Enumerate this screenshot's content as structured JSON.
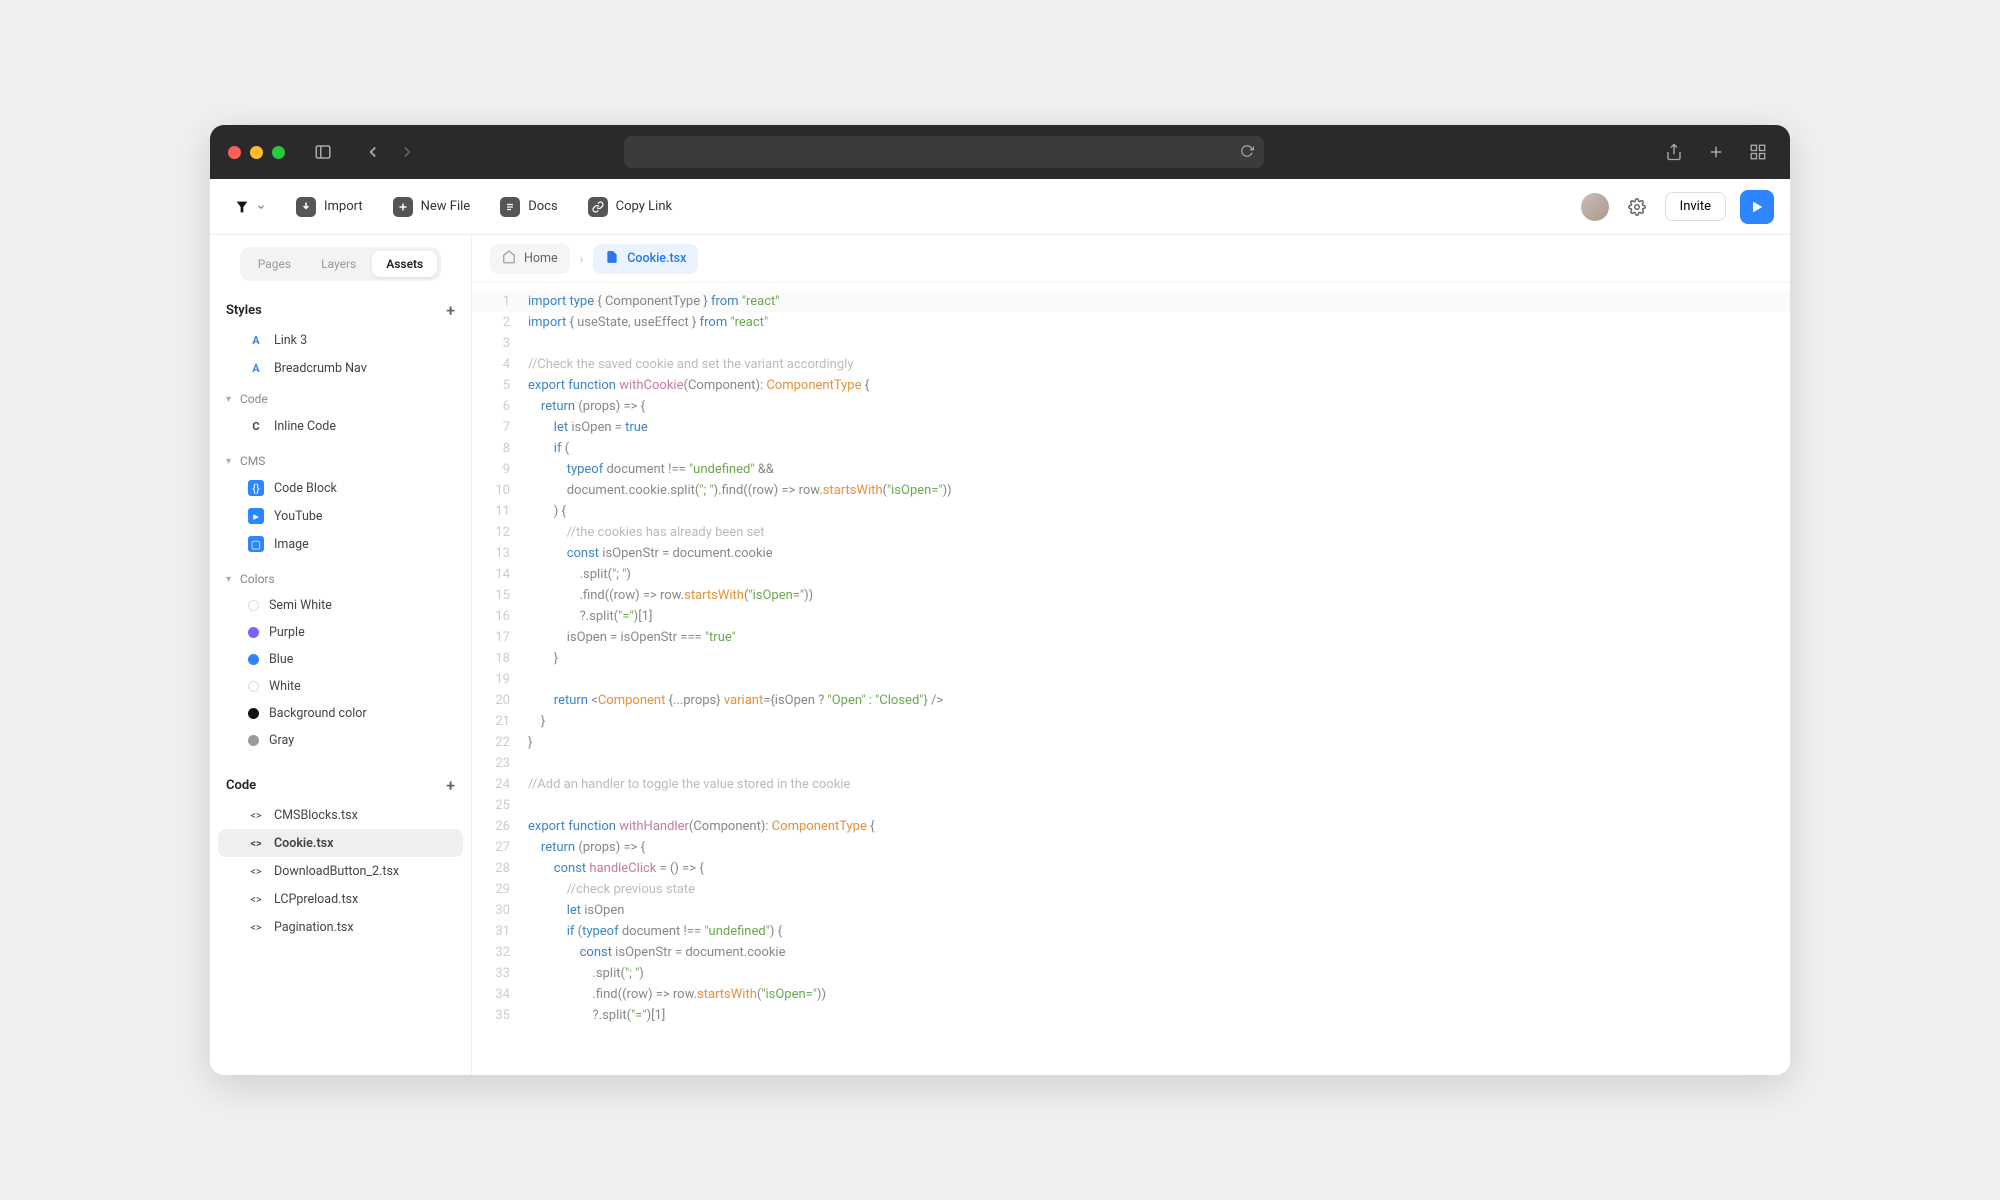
{
  "toolbar": {
    "import": "Import",
    "newfile": "New File",
    "docs": "Docs",
    "copylink": "Copy Link",
    "invite": "Invite"
  },
  "sidebar": {
    "tabs": {
      "pages": "Pages",
      "layers": "Layers",
      "assets": "Assets"
    },
    "styles_header": "Styles",
    "code_header": "Code",
    "styles_items": {
      "link3": "Link 3",
      "breadcrumb": "Breadcrumb Nav"
    },
    "groups": {
      "code": "Code",
      "cms": "CMS",
      "colors": "Colors"
    },
    "code_group": {
      "inline": "Inline Code"
    },
    "cms_group": {
      "codeblock": "Code Block",
      "youtube": "YouTube",
      "image": "Image"
    },
    "colors_group": {
      "semiwhite": "Semi White",
      "purple": "Purple",
      "blue": "Blue",
      "white": "White",
      "background": "Background color",
      "gray": "Gray"
    },
    "colors_hex": {
      "semiwhite": "#f7f7f7",
      "purple": "#7b61ff",
      "blue": "#2D86FF",
      "white": "#ffffff",
      "background": "#111111",
      "gray": "#9a9a9a"
    },
    "files": {
      "cmsblocks": "CMSBlocks.tsx",
      "cookie": "Cookie.tsx",
      "downloadbtn": "DownloadButton_2.tsx",
      "lcppreload": "LCPpreload.tsx",
      "pagination": "Pagination.tsx"
    }
  },
  "breadcrumb": {
    "home": "Home",
    "file": "Cookie.tsx"
  },
  "code_lines": [
    {
      "n": 1,
      "hl": true,
      "seg": [
        [
          "kw",
          "import"
        ],
        [
          "op",
          " "
        ],
        [
          "kw",
          "type"
        ],
        [
          "op",
          " { "
        ],
        [
          "id",
          "ComponentType"
        ],
        [
          "op",
          " } "
        ],
        [
          "kw",
          "from"
        ],
        [
          "op",
          " "
        ],
        [
          "str",
          "\"react\""
        ]
      ]
    },
    {
      "n": 2,
      "seg": [
        [
          "kw",
          "import"
        ],
        [
          "op",
          " { "
        ],
        [
          "id",
          "useState, useEffect"
        ],
        [
          "op",
          " } "
        ],
        [
          "kw",
          "from"
        ],
        [
          "op",
          " "
        ],
        [
          "str",
          "\"react\""
        ]
      ]
    },
    {
      "n": 3,
      "seg": []
    },
    {
      "n": 4,
      "seg": [
        [
          "com",
          "//Check the saved cookie and set the variant accordingly"
        ]
      ]
    },
    {
      "n": 5,
      "seg": [
        [
          "kw",
          "export"
        ],
        [
          "op",
          " "
        ],
        [
          "kw",
          "function"
        ],
        [
          "op",
          " "
        ],
        [
          "fn",
          "withCookie"
        ],
        [
          "op",
          "("
        ],
        [
          "id",
          "Component"
        ],
        [
          "op",
          "): "
        ],
        [
          "type",
          "ComponentType"
        ],
        [
          "op",
          " {"
        ]
      ]
    },
    {
      "n": 6,
      "seg": [
        [
          "op",
          "    "
        ],
        [
          "kw",
          "return"
        ],
        [
          "op",
          " (props) => {"
        ]
      ]
    },
    {
      "n": 7,
      "seg": [
        [
          "op",
          "        "
        ],
        [
          "kw",
          "let"
        ],
        [
          "op",
          " isOpen = "
        ],
        [
          "kw",
          "true"
        ]
      ]
    },
    {
      "n": 8,
      "seg": [
        [
          "op",
          "        "
        ],
        [
          "kw",
          "if"
        ],
        [
          "op",
          " ("
        ]
      ]
    },
    {
      "n": 9,
      "seg": [
        [
          "op",
          "            "
        ],
        [
          "kw",
          "typeof"
        ],
        [
          "op",
          " document !== "
        ],
        [
          "str",
          "\"undefined\""
        ],
        [
          "op",
          " &&"
        ]
      ]
    },
    {
      "n": 10,
      "seg": [
        [
          "op",
          "            document.cookie.split("
        ],
        [
          "str",
          "\"; \""
        ],
        [
          "op",
          ").find((row) => "
        ],
        [
          "id",
          "row"
        ],
        [
          "op",
          "."
        ],
        [
          "prop",
          "startsWith"
        ],
        [
          "op",
          "("
        ],
        [
          "str",
          "\"isOpen=\""
        ],
        [
          "op",
          "))"
        ]
      ]
    },
    {
      "n": 11,
      "seg": [
        [
          "op",
          "        ) {"
        ]
      ]
    },
    {
      "n": 12,
      "seg": [
        [
          "op",
          "            "
        ],
        [
          "com",
          "//the cookies has already been set"
        ]
      ]
    },
    {
      "n": 13,
      "seg": [
        [
          "op",
          "            "
        ],
        [
          "kw",
          "const"
        ],
        [
          "op",
          " isOpenStr = document.cookie"
        ]
      ]
    },
    {
      "n": 14,
      "seg": [
        [
          "op",
          "                .split("
        ],
        [
          "str",
          "\"; \""
        ],
        [
          "op",
          ")"
        ]
      ]
    },
    {
      "n": 15,
      "seg": [
        [
          "op",
          "                .find((row) => "
        ],
        [
          "id",
          "row"
        ],
        [
          "op",
          "."
        ],
        [
          "prop",
          "startsWith"
        ],
        [
          "op",
          "("
        ],
        [
          "str",
          "\"isOpen=\""
        ],
        [
          "op",
          "))"
        ]
      ]
    },
    {
      "n": 16,
      "seg": [
        [
          "op",
          "                ?.split("
        ],
        [
          "str",
          "\"=\""
        ],
        [
          "op",
          ")[1]"
        ]
      ]
    },
    {
      "n": 17,
      "seg": [
        [
          "op",
          "            isOpen = isOpenStr === "
        ],
        [
          "str",
          "\"true\""
        ]
      ]
    },
    {
      "n": 18,
      "seg": [
        [
          "op",
          "        }"
        ]
      ]
    },
    {
      "n": 19,
      "seg": []
    },
    {
      "n": 20,
      "seg": [
        [
          "op",
          "        "
        ],
        [
          "kw",
          "return"
        ],
        [
          "op",
          " <"
        ],
        [
          "type",
          "Component"
        ],
        [
          "op",
          " {...props} "
        ],
        [
          "prop",
          "variant"
        ],
        [
          "op",
          "={isOpen ? "
        ],
        [
          "str",
          "\"Open\""
        ],
        [
          "op",
          " : "
        ],
        [
          "str",
          "\"Closed\""
        ],
        [
          "op",
          "} />"
        ]
      ]
    },
    {
      "n": 21,
      "seg": [
        [
          "op",
          "    }"
        ]
      ]
    },
    {
      "n": 22,
      "seg": [
        [
          "op",
          "}"
        ]
      ]
    },
    {
      "n": 23,
      "seg": []
    },
    {
      "n": 24,
      "seg": [
        [
          "com",
          "//Add an handler to toggle the value stored in the cookie"
        ]
      ]
    },
    {
      "n": 25,
      "seg": []
    },
    {
      "n": 26,
      "seg": [
        [
          "kw",
          "export"
        ],
        [
          "op",
          " "
        ],
        [
          "kw",
          "function"
        ],
        [
          "op",
          " "
        ],
        [
          "fn",
          "withHandler"
        ],
        [
          "op",
          "("
        ],
        [
          "id",
          "Component"
        ],
        [
          "op",
          "): "
        ],
        [
          "type",
          "ComponentType"
        ],
        [
          "op",
          " {"
        ]
      ]
    },
    {
      "n": 27,
      "seg": [
        [
          "op",
          "    "
        ],
        [
          "kw",
          "return"
        ],
        [
          "op",
          " (props) => {"
        ]
      ]
    },
    {
      "n": 28,
      "seg": [
        [
          "op",
          "        "
        ],
        [
          "kw",
          "const"
        ],
        [
          "op",
          " "
        ],
        [
          "fn",
          "handleClick"
        ],
        [
          "op",
          " = () => {"
        ]
      ]
    },
    {
      "n": 29,
      "seg": [
        [
          "op",
          "            "
        ],
        [
          "com",
          "//check previous state"
        ]
      ]
    },
    {
      "n": 30,
      "seg": [
        [
          "op",
          "            "
        ],
        [
          "kw",
          "let"
        ],
        [
          "op",
          " isOpen"
        ]
      ]
    },
    {
      "n": 31,
      "seg": [
        [
          "op",
          "            "
        ],
        [
          "kw",
          "if"
        ],
        [
          "op",
          " ("
        ],
        [
          "kw",
          "typeof"
        ],
        [
          "op",
          " document !== "
        ],
        [
          "str",
          "\"undefined\""
        ],
        [
          "op",
          ") {"
        ]
      ]
    },
    {
      "n": 32,
      "seg": [
        [
          "op",
          "                "
        ],
        [
          "kw",
          "const"
        ],
        [
          "op",
          " isOpenStr = document.cookie"
        ]
      ]
    },
    {
      "n": 33,
      "seg": [
        [
          "op",
          "                    .split("
        ],
        [
          "str",
          "\"; \""
        ],
        [
          "op",
          ")"
        ]
      ]
    },
    {
      "n": 34,
      "seg": [
        [
          "op",
          "                    .find((row) => "
        ],
        [
          "id",
          "row"
        ],
        [
          "op",
          "."
        ],
        [
          "prop",
          "startsWith"
        ],
        [
          "op",
          "("
        ],
        [
          "str",
          "\"isOpen=\""
        ],
        [
          "op",
          "))"
        ]
      ]
    },
    {
      "n": 35,
      "seg": [
        [
          "op",
          "                    ?.split("
        ],
        [
          "str",
          "\"=\""
        ],
        [
          "op",
          ")[1]"
        ]
      ]
    }
  ]
}
